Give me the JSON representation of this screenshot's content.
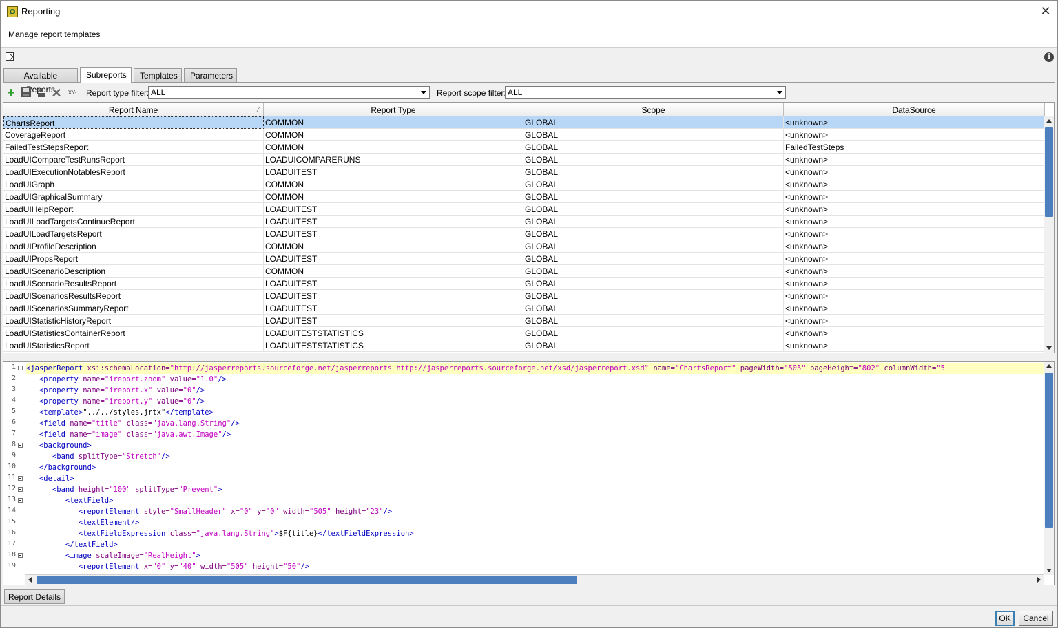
{
  "window": {
    "title": "Reporting",
    "subtitle": "Manage report templates"
  },
  "tabs": [
    {
      "label": "Available Reports",
      "active": false
    },
    {
      "label": "Subreports",
      "active": true
    },
    {
      "label": "Templates",
      "active": false
    },
    {
      "label": "Parameters",
      "active": false
    }
  ],
  "toolbar": {
    "xy_label": "XY-",
    "type_filter_label": "Report type filter:",
    "type_filter_value": "ALL",
    "scope_filter_label": "Report scope filter:",
    "scope_filter_value": "ALL"
  },
  "table": {
    "columns": [
      "Report Name",
      "Report Type",
      "Scope",
      "DataSource"
    ],
    "sort_glyph": "⁄",
    "rows": [
      [
        "ChartsReport",
        "COMMON",
        "GLOBAL",
        "<unknown>"
      ],
      [
        "CoverageReport",
        "COMMON",
        "GLOBAL",
        "<unknown>"
      ],
      [
        "FailedTestStepsReport",
        "COMMON",
        "GLOBAL",
        "FailedTestSteps"
      ],
      [
        "LoadUICompareTestRunsReport",
        "LOADUICOMPARERUNS",
        "GLOBAL",
        "<unknown>"
      ],
      [
        "LoadUIExecutionNotablesReport",
        "LOADUITEST",
        "GLOBAL",
        "<unknown>"
      ],
      [
        "LoadUIGraph",
        "COMMON",
        "GLOBAL",
        "<unknown>"
      ],
      [
        "LoadUIGraphicalSummary",
        "COMMON",
        "GLOBAL",
        "<unknown>"
      ],
      [
        "LoadUIHelpReport",
        "LOADUITEST",
        "GLOBAL",
        "<unknown>"
      ],
      [
        "LoadUILoadTargetsContinueReport",
        "LOADUITEST",
        "GLOBAL",
        "<unknown>"
      ],
      [
        "LoadUILoadTargetsReport",
        "LOADUITEST",
        "GLOBAL",
        "<unknown>"
      ],
      [
        "LoadUIProfileDescription",
        "COMMON",
        "GLOBAL",
        "<unknown>"
      ],
      [
        "LoadUIPropsReport",
        "LOADUITEST",
        "GLOBAL",
        "<unknown>"
      ],
      [
        "LoadUIScenarioDescription",
        "COMMON",
        "GLOBAL",
        "<unknown>"
      ],
      [
        "LoadUIScenarioResultsReport",
        "LOADUITEST",
        "GLOBAL",
        "<unknown>"
      ],
      [
        "LoadUIScenariosResultsReport",
        "LOADUITEST",
        "GLOBAL",
        "<unknown>"
      ],
      [
        "LoadUIScenariosSummaryReport",
        "LOADUITEST",
        "GLOBAL",
        "<unknown>"
      ],
      [
        "LoadUIStatisticHistoryReport",
        "LOADUITEST",
        "GLOBAL",
        "<unknown>"
      ],
      [
        "LoadUIStatisticsContainerReport",
        "LOADUITESTSTATISTICS",
        "GLOBAL",
        "<unknown>"
      ],
      [
        "LoadUIStatisticsReport",
        "LOADUITESTSTATISTICS",
        "GLOBAL",
        "<unknown>"
      ]
    ]
  },
  "editor": {
    "lines": [
      {
        "n": "1",
        "fold": true,
        "html": "<span class=\"t\">&lt;jasperReport</span> <span class=\"a\">xsi:schemaLocation=</span><span class=\"v\">\"http://jasperreports.sourceforge.net/jasperreports http://jasperreports.sourceforge.net/xsd/jasperreport.xsd\"</span> <span class=\"a\">name=</span><span class=\"v\">\"ChartsReport\"</span> <span class=\"a\">pageWidth=</span><span class=\"v\">\"505\"</span> <span class=\"a\">pageHeight=</span><span class=\"v\">\"802\"</span> <span class=\"a\">columnWidth=</span><span class=\"v\">\"5</span>"
      },
      {
        "n": "2",
        "fold": false,
        "html": "   <span class=\"t\">&lt;property</span> <span class=\"a\">name=</span><span class=\"v\">\"ireport.zoom\"</span> <span class=\"a\">value=</span><span class=\"v\">\"1.0\"</span><span class=\"t\">/&gt;</span>"
      },
      {
        "n": "3",
        "fold": false,
        "html": "   <span class=\"t\">&lt;property</span> <span class=\"a\">name=</span><span class=\"v\">\"ireport.x\"</span> <span class=\"a\">value=</span><span class=\"v\">\"0\"</span><span class=\"t\">/&gt;</span>"
      },
      {
        "n": "4",
        "fold": false,
        "html": "   <span class=\"t\">&lt;property</span> <span class=\"a\">name=</span><span class=\"v\">\"ireport.y\"</span> <span class=\"a\">value=</span><span class=\"v\">\"0\"</span><span class=\"t\">/&gt;</span>"
      },
      {
        "n": "5",
        "fold": false,
        "html": "   <span class=\"t\">&lt;template&gt;</span>\"../../styles.jrtx\"<span class=\"t\">&lt;/template&gt;</span>"
      },
      {
        "n": "6",
        "fold": false,
        "html": "   <span class=\"t\">&lt;field</span> <span class=\"a\">name=</span><span class=\"v\">\"title\"</span> <span class=\"a\">class=</span><span class=\"v\">\"java.lang.String\"</span><span class=\"t\">/&gt;</span>"
      },
      {
        "n": "7",
        "fold": false,
        "html": "   <span class=\"t\">&lt;field</span> <span class=\"a\">name=</span><span class=\"v\">\"image\"</span> <span class=\"a\">class=</span><span class=\"v\">\"java.awt.Image\"</span><span class=\"t\">/&gt;</span>"
      },
      {
        "n": "8",
        "fold": true,
        "html": "   <span class=\"t\">&lt;background&gt;</span>"
      },
      {
        "n": "9",
        "fold": false,
        "html": "      <span class=\"t\">&lt;band</span> <span class=\"a\">splitType=</span><span class=\"v\">\"Stretch\"</span><span class=\"t\">/&gt;</span>"
      },
      {
        "n": "10",
        "fold": false,
        "html": "   <span class=\"t\">&lt;/background&gt;</span>"
      },
      {
        "n": "11",
        "fold": true,
        "html": "   <span class=\"t\">&lt;detail&gt;</span>"
      },
      {
        "n": "12",
        "fold": true,
        "html": "      <span class=\"t\">&lt;band</span> <span class=\"a\">height=</span><span class=\"v\">\"100\"</span> <span class=\"a\">splitType=</span><span class=\"v\">\"Prevent\"</span><span class=\"t\">&gt;</span>"
      },
      {
        "n": "13",
        "fold": true,
        "html": "         <span class=\"t\">&lt;textField&gt;</span>"
      },
      {
        "n": "14",
        "fold": false,
        "html": "            <span class=\"t\">&lt;reportElement</span> <span class=\"a\">style=</span><span class=\"v\">\"SmallHeader\"</span> <span class=\"a\">x=</span><span class=\"v\">\"0\"</span> <span class=\"a\">y=</span><span class=\"v\">\"0\"</span> <span class=\"a\">width=</span><span class=\"v\">\"505\"</span> <span class=\"a\">height=</span><span class=\"v\">\"23\"</span><span class=\"t\">/&gt;</span>"
      },
      {
        "n": "15",
        "fold": false,
        "html": "            <span class=\"t\">&lt;textElement/&gt;</span>"
      },
      {
        "n": "16",
        "fold": false,
        "html": "            <span class=\"t\">&lt;textFieldExpression</span> <span class=\"a\">class=</span><span class=\"v\">\"java.lang.String\"</span><span class=\"t\">&gt;</span>$F{title}<span class=\"t\">&lt;/textFieldExpression&gt;</span>"
      },
      {
        "n": "17",
        "fold": false,
        "html": "         <span class=\"t\">&lt;/textField&gt;</span>"
      },
      {
        "n": "18",
        "fold": true,
        "html": "         <span class=\"t\">&lt;image</span> <span class=\"a\">scaleImage=</span><span class=\"v\">\"RealHeight\"</span><span class=\"t\">&gt;</span>"
      },
      {
        "n": "19",
        "fold": false,
        "html": "            <span class=\"t\">&lt;reportElement</span> <span class=\"a\">x=</span><span class=\"v\">\"0\"</span> <span class=\"a\">y=</span><span class=\"v\">\"40\"</span> <span class=\"a\">width=</span><span class=\"v\">\"505\"</span> <span class=\"a\">height=</span><span class=\"v\">\"50\"</span><span class=\"t\">/&gt;</span>"
      }
    ]
  },
  "bottom_tab": "Report Details",
  "buttons": {
    "ok": "OK",
    "cancel": "Cancel"
  },
  "colors": {
    "selection": "#b8d6f5",
    "scroll_thumb": "#4d7fbf",
    "code_highlight": "#ffffc0"
  }
}
